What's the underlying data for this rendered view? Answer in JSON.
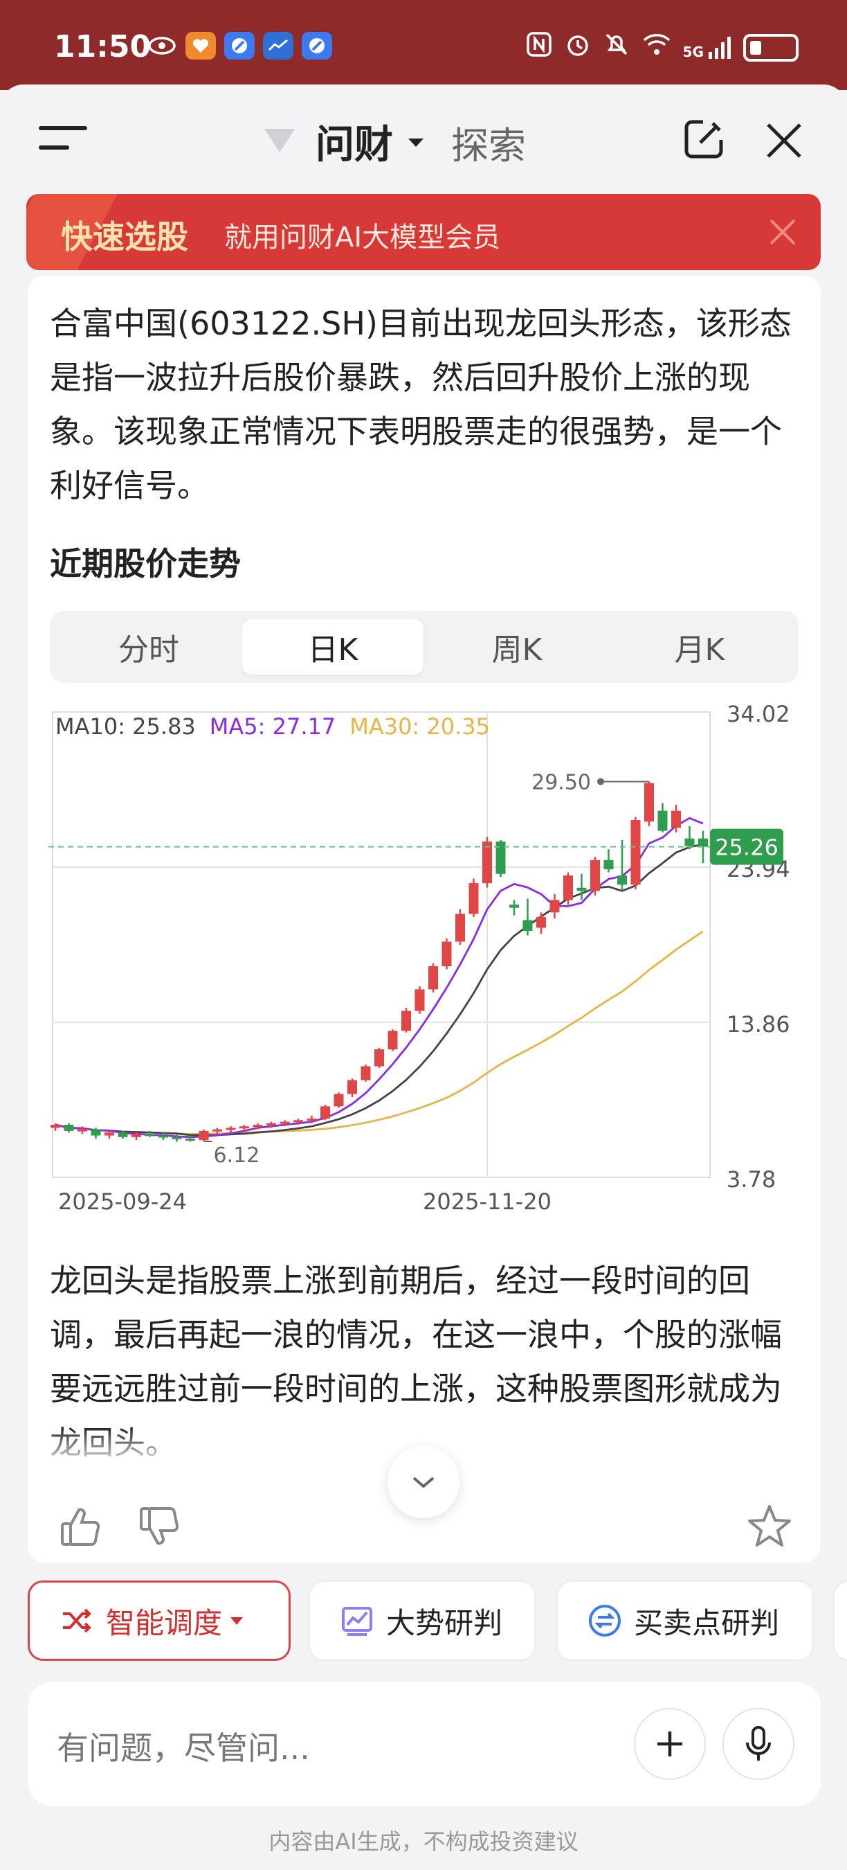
{
  "status_bar": {
    "time": "11:50",
    "network": "5G"
  },
  "header": {
    "brand": "问财",
    "second_tab": "探索"
  },
  "banner": {
    "badge": "快速选股",
    "text": "就用问财AI大模型会员"
  },
  "content": {
    "intro": "合富中国(603122.SH)目前出现龙回头形态，该形态是指一波拉升后股价暴跌，然后回升股价上涨的现象。该现象正常情况下表明股票走的很强势，是一个利好信号。",
    "section_title": "近期股价走势",
    "period_tabs": [
      "分时",
      "日K",
      "周K",
      "月K"
    ],
    "active_tab": "日K",
    "explanation": "龙回头是指股票上涨到前期后，经过一段时间的回调，最后再起一浪的情况，在这一浪中，个股的涨幅要远远胜过前一段时间的上涨，这种股票图形就成为龙回头。"
  },
  "chart_data": {
    "type": "candlestick",
    "ma_legend": [
      {
        "label": "MA10: 25.83",
        "color": "#444444"
      },
      {
        "label": "MA5: 27.17",
        "color": "#8a2be2"
      },
      {
        "label": "MA30: 20.35",
        "color": "#e8b443"
      }
    ],
    "y_ticks": [
      "34.02",
      "23.94",
      "13.86",
      "3.78"
    ],
    "ylim": [
      3.78,
      34.02
    ],
    "x_ticks": [
      "2025-09-24",
      "2025-11-20"
    ],
    "current_price": "25.26",
    "high_label": "29.50",
    "low_label": "6.12",
    "candles": [
      [
        7.0,
        7.3,
        6.8,
        7.2
      ],
      [
        7.2,
        7.3,
        6.7,
        6.8
      ],
      [
        6.8,
        7.1,
        6.6,
        6.9
      ],
      [
        6.9,
        7.0,
        6.3,
        6.5
      ],
      [
        6.5,
        6.8,
        6.3,
        6.7
      ],
      [
        6.7,
        6.8,
        6.3,
        6.4
      ],
      [
        6.4,
        6.7,
        6.2,
        6.6
      ],
      [
        6.6,
        6.8,
        6.4,
        6.5
      ],
      [
        6.5,
        6.7,
        6.2,
        6.4
      ],
      [
        6.4,
        6.6,
        6.1,
        6.3
      ],
      [
        6.3,
        6.5,
        6.1,
        6.2
      ],
      [
        6.2,
        6.9,
        6.12,
        6.8
      ],
      [
        6.8,
        7.0,
        6.6,
        6.9
      ],
      [
        6.9,
        7.1,
        6.7,
        7.0
      ],
      [
        7.0,
        7.2,
        6.8,
        7.1
      ],
      [
        7.1,
        7.3,
        6.9,
        7.2
      ],
      [
        7.2,
        7.4,
        7.0,
        7.3
      ],
      [
        7.3,
        7.5,
        7.1,
        7.4
      ],
      [
        7.4,
        7.6,
        7.2,
        7.5
      ],
      [
        7.5,
        7.8,
        7.3,
        7.6
      ],
      [
        7.6,
        8.5,
        7.5,
        8.4
      ],
      [
        8.4,
        9.3,
        8.3,
        9.2
      ],
      [
        9.2,
        10.2,
        9.0,
        10.1
      ],
      [
        10.1,
        11.1,
        10.0,
        11.0
      ],
      [
        11.0,
        12.2,
        10.9,
        12.1
      ],
      [
        12.1,
        13.4,
        12.0,
        13.3
      ],
      [
        13.3,
        14.8,
        13.2,
        14.6
      ],
      [
        14.6,
        16.2,
        14.4,
        16.0
      ],
      [
        16.0,
        17.7,
        15.8,
        17.5
      ],
      [
        17.5,
        19.3,
        17.3,
        19.1
      ],
      [
        19.1,
        21.2,
        18.9,
        20.9
      ],
      [
        20.9,
        23.2,
        20.7,
        22.9
      ],
      [
        22.9,
        25.9,
        22.6,
        25.6
      ],
      [
        25.6,
        25.7,
        23.3,
        23.5
      ],
      [
        21.5,
        21.8,
        20.8,
        21.3
      ],
      [
        20.5,
        21.9,
        19.5,
        19.8
      ],
      [
        20.0,
        21.0,
        19.6,
        20.7
      ],
      [
        21.0,
        22.2,
        20.6,
        21.8
      ],
      [
        21.8,
        23.6,
        21.5,
        23.4
      ],
      [
        22.6,
        23.5,
        21.8,
        22.4
      ],
      [
        22.4,
        24.6,
        22.1,
        24.4
      ],
      [
        24.4,
        25.1,
        23.6,
        23.8
      ],
      [
        23.4,
        25.7,
        22.4,
        22.8
      ],
      [
        22.8,
        27.2,
        22.5,
        27.0
      ],
      [
        26.9,
        29.5,
        26.6,
        29.4
      ],
      [
        27.6,
        28.1,
        26.2,
        26.3
      ],
      [
        26.5,
        28.0,
        26.2,
        27.6
      ],
      [
        25.8,
        26.6,
        25.1,
        25.3
      ],
      [
        25.8,
        26.3,
        24.2,
        25.26
      ]
    ]
  },
  "feedback": {
    "like": "like",
    "dislike": "dislike",
    "favorite": "favorite"
  },
  "actions": [
    {
      "label": "智能调度",
      "icon": "shuffle-icon"
    },
    {
      "label": "大势研判",
      "icon": "trend-chart-icon"
    },
    {
      "label": "买卖点研判",
      "icon": "exchange-icon"
    }
  ],
  "input": {
    "placeholder": "有问题，尽管问..."
  },
  "disclaimer": "内容由AI生成，不构成投资建议"
}
